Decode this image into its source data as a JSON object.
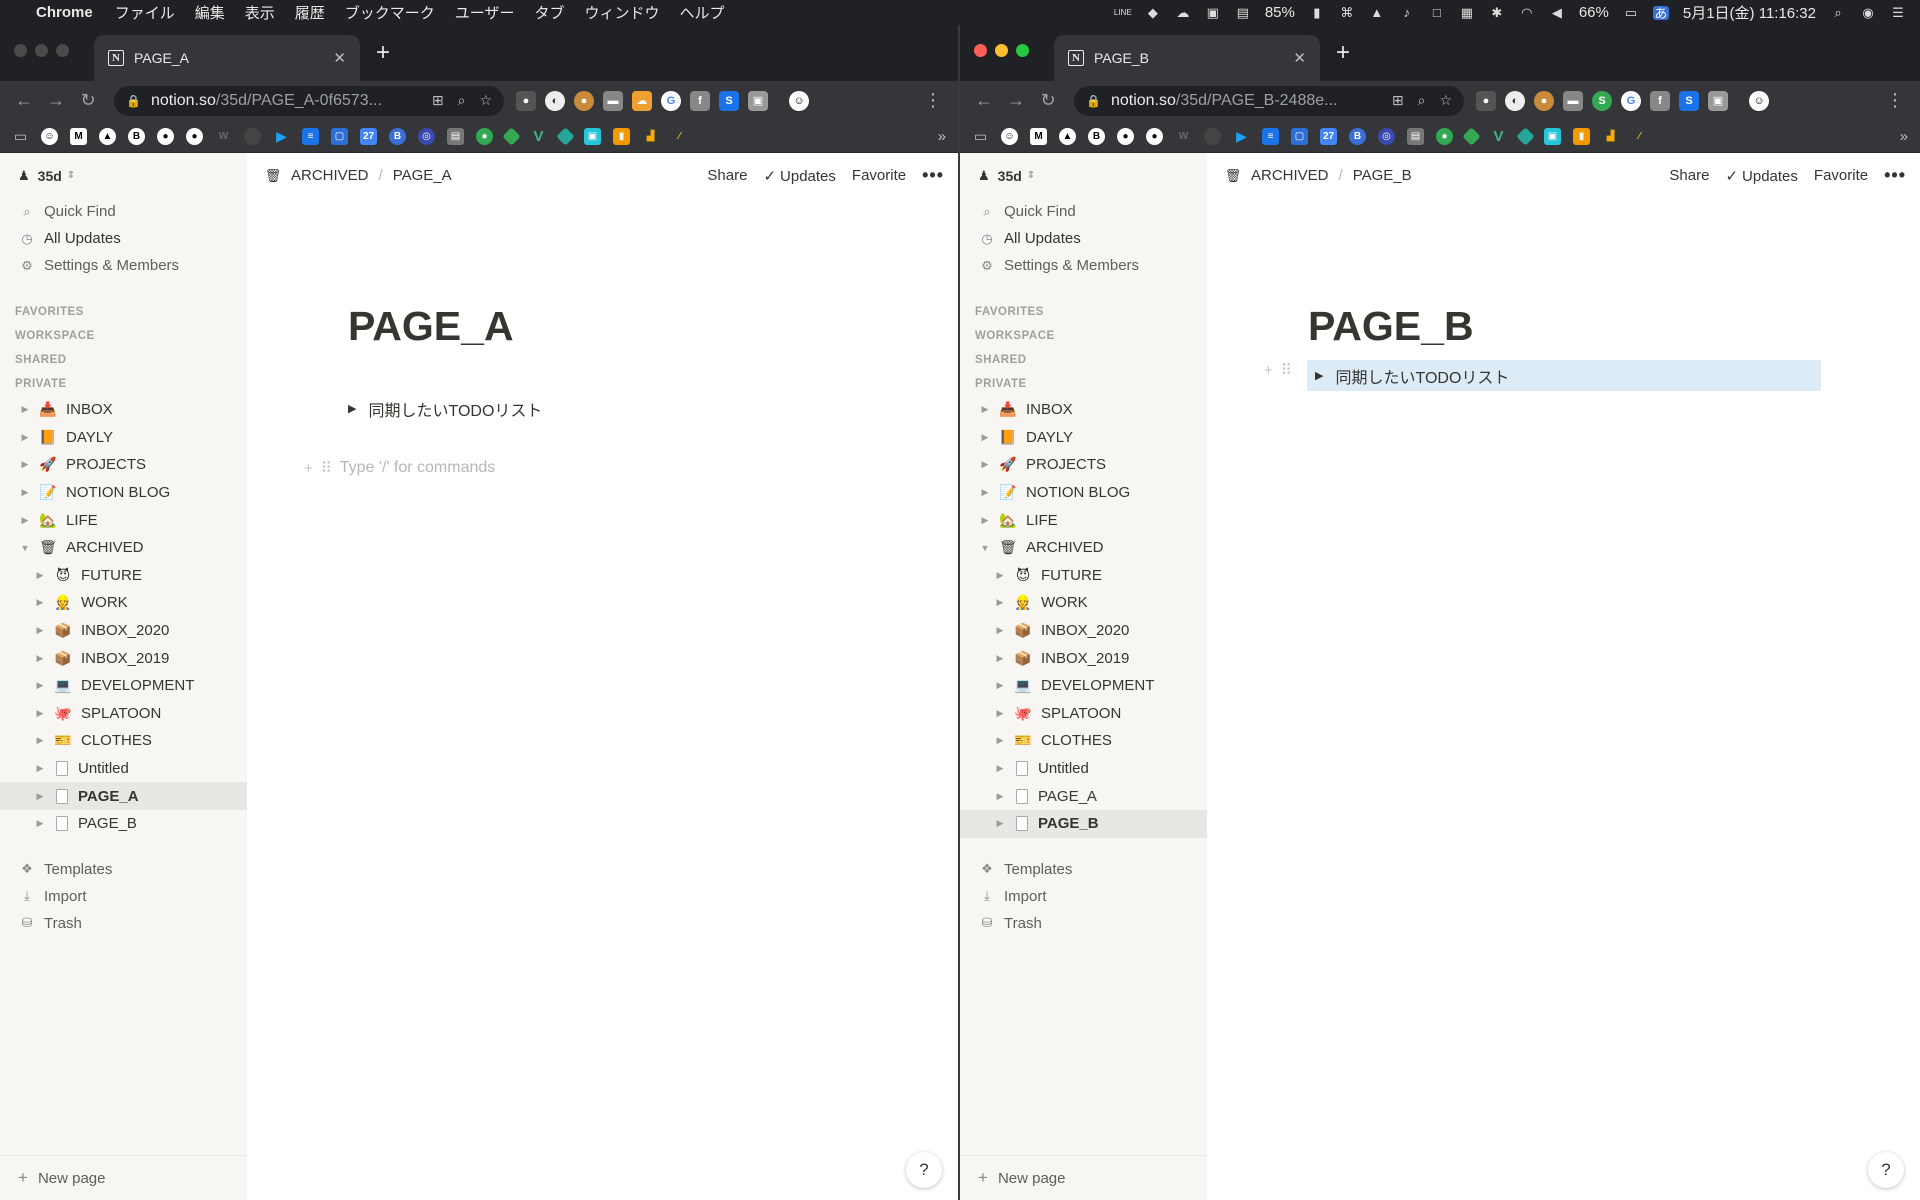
{
  "menubar": {
    "app": "Chrome",
    "items": [
      "ファイル",
      "編集",
      "表示",
      "履歴",
      "ブックマーク",
      "ユーザー",
      "タブ",
      "ウィンドウ",
      "ヘルプ"
    ],
    "battery_small": "85%",
    "battery": "66%",
    "input_mode": "あ",
    "datetime": "5月1日(金)  11:16:32"
  },
  "window_a": {
    "tab_title": "PAGE_A",
    "url_host": "notion.so",
    "url_path": "/35d/PAGE_A-0f6573..."
  },
  "window_b": {
    "tab_title": "PAGE_B",
    "url_host": "notion.so",
    "url_path": "/35d/PAGE_B-2488e..."
  },
  "sidebar": {
    "workspace": "35d",
    "actions": [
      "Quick Find",
      "All Updates",
      "Settings & Members"
    ],
    "sections": [
      "FAVORITES",
      "WORKSPACE",
      "SHARED",
      "PRIVATE"
    ],
    "top_pages": [
      {
        "label": "INBOX",
        "icon": "📥"
      },
      {
        "label": "DAYLY",
        "icon": "📙"
      },
      {
        "label": "PROJECTS",
        "icon": "🚀"
      },
      {
        "label": "NOTION BLOG",
        "icon": "📝"
      },
      {
        "label": "LIFE",
        "icon": "🏡"
      },
      {
        "label": "ARCHIVED",
        "icon": "🗑"
      }
    ],
    "archived_children": [
      {
        "label": "FUTURE",
        "icon": "😈"
      },
      {
        "label": "WORK",
        "icon": "👷"
      },
      {
        "label": "INBOX_2020",
        "icon": "📦"
      },
      {
        "label": "INBOX_2019",
        "icon": "📦"
      },
      {
        "label": "DEVELOPMENT",
        "icon": "💻"
      },
      {
        "label": "SPLATOON",
        "icon": "🐙"
      },
      {
        "label": "CLOTHES",
        "icon": "🎫"
      },
      {
        "label": "Untitled",
        "icon": ""
      },
      {
        "label": "PAGE_A",
        "icon": ""
      },
      {
        "label": "PAGE_B",
        "icon": ""
      }
    ],
    "footer_actions": [
      "Templates",
      "Import",
      "Trash"
    ],
    "new_page": "New page"
  },
  "topbar": {
    "crumb_parent": "ARCHIVED",
    "crumb_sep": "/",
    "share": "Share",
    "updates": "Updates",
    "favorite": "Favorite",
    "more": "•••"
  },
  "page_a": {
    "crumb": "PAGE_A",
    "title": "PAGE_A",
    "toggle": "同期したいTODOリスト",
    "placeholder": "Type '/' for commands"
  },
  "page_b": {
    "crumb": "PAGE_B",
    "title": "PAGE_B",
    "toggle": "同期したいTODOリスト"
  },
  "help": "?",
  "colors": {
    "sidebar_bg": "#f7f6f3",
    "selected_row": "#e8e7e4",
    "block_selection": "#ddebf7",
    "chrome_dark": "#202124",
    "chrome_toolbar": "#35363a"
  }
}
